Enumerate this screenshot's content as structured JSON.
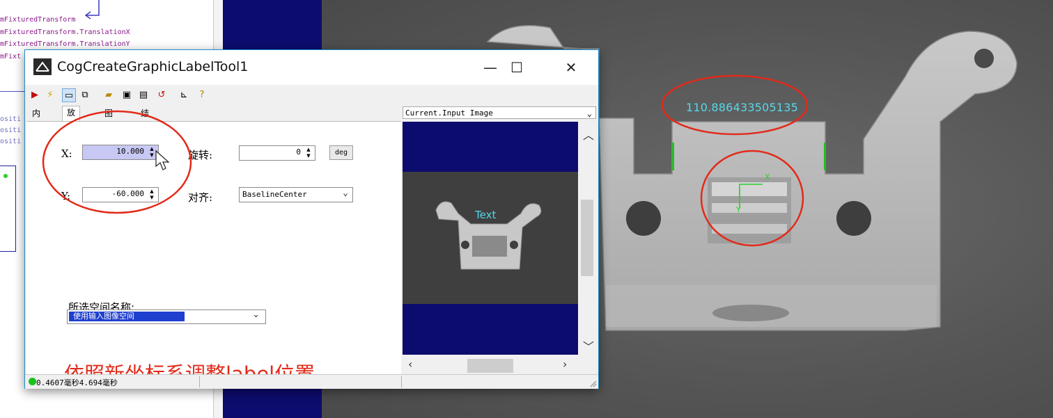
{
  "background_code": {
    "lines": [
      "mFixturedTransform",
      "mFixturedTransform.TranslationX",
      "mFixturedTransform.TranslationY",
      "mFixt"
    ],
    "side_lines": [
      "ositi",
      "ositi",
      "ositi"
    ]
  },
  "vision_display": {
    "result_text": "110.886433505135"
  },
  "dialog": {
    "title": "CogCreateGraphicLabelTool1",
    "window_buttons": {
      "minimize": "—",
      "maximize": "☐",
      "close": "✕"
    },
    "tabs": [
      "内容",
      "放置",
      "图形",
      "结果"
    ],
    "selected_tab": "放置",
    "fields": {
      "x_label": "X:",
      "x_value": "10.000",
      "y_label": "Y:",
      "y_value": "-60.000",
      "rotation_label": "旋转:",
      "rotation_value": "0",
      "rotation_unit": "deg",
      "align_label": "对齐:",
      "align_value": "BaselineCenter",
      "space_label": "所选空间名称:",
      "space_value": "使用输入图像空间"
    },
    "annotation": "依照新坐标系调整label位置",
    "image_pane": {
      "dropdown": "Current.Input Image",
      "preview_text": "Text"
    },
    "status": "0.4607毫秒4.694毫秒"
  },
  "colors": {
    "annotation_red": "#e22a1a",
    "cyan_text": "#55d8e8",
    "navy": "#0c0c6e",
    "status_green": "#19c219"
  }
}
